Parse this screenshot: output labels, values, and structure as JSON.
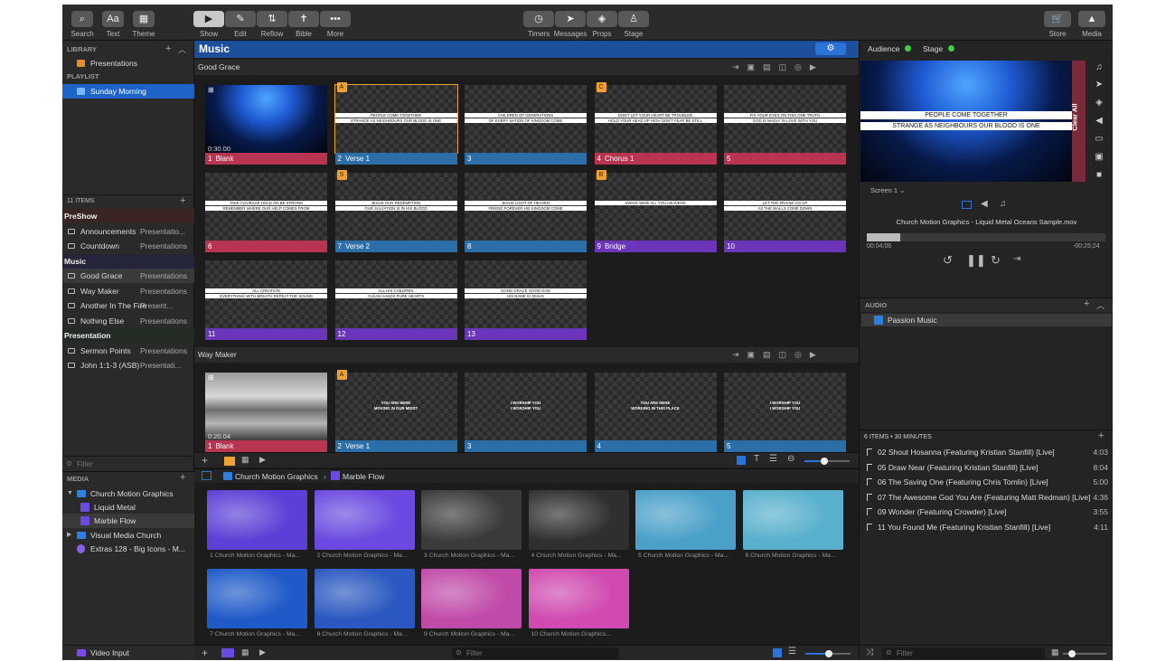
{
  "toolbar": {
    "left": [
      {
        "label": "Search",
        "icon": "magnifier-icon"
      },
      {
        "label": "Text",
        "glyph": "Aa"
      },
      {
        "label": "Theme",
        "icon": "theme-icon"
      }
    ],
    "mode": [
      {
        "label": "Show"
      },
      {
        "label": "Edit"
      },
      {
        "label": "Reflow"
      },
      {
        "label": "Bible"
      },
      {
        "label": "More"
      }
    ],
    "center": [
      {
        "label": "Timers"
      },
      {
        "label": "Messages"
      },
      {
        "label": "Props"
      },
      {
        "label": "Stage"
      }
    ],
    "right": [
      {
        "label": "Store"
      },
      {
        "label": "Media"
      }
    ]
  },
  "library": {
    "header": "LIBRARY",
    "presentations": "Presentations",
    "playlist_header": "PLAYLIST",
    "playlist": "Sunday Morning",
    "items_count": "11 ITEMS",
    "groups": [
      {
        "name": "PreShow",
        "items": [
          {
            "name": "Announcements",
            "type": "Presentatio..."
          },
          {
            "name": "Countdown",
            "type": "Presentations"
          }
        ]
      },
      {
        "name": "Music",
        "items": [
          {
            "name": "Good Grace",
            "type": "Presentations"
          },
          {
            "name": "Way Maker",
            "type": "Presentations"
          },
          {
            "name": "Another In The Fire",
            "type": "Present..."
          },
          {
            "name": "Nothing Else",
            "type": "Presentations"
          }
        ]
      },
      {
        "name": "Presentation",
        "items": [
          {
            "name": "Sermon Points",
            "type": "Presentations"
          },
          {
            "name": "John 1:1-3 (ASB)",
            "type": "Presentati..."
          }
        ]
      }
    ],
    "filter": "Filter"
  },
  "media_tree": {
    "header": "MEDIA",
    "items": [
      {
        "name": "Church Motion Graphics"
      },
      {
        "name": "Liquid Metal"
      },
      {
        "name": "Marble Flow"
      },
      {
        "name": "Visual Media Church"
      },
      {
        "name": "Extras 128 - Big Icons - M..."
      }
    ],
    "video_input": "Video Input"
  },
  "center": {
    "title": "Music",
    "sections": [
      {
        "name": "Good Grace",
        "slides": [
          {
            "num": "1",
            "label": "Blank",
            "time": "0:30.00",
            "color": "red",
            "kind": "ocean",
            "l1": "",
            "l2": ""
          },
          {
            "num": "2",
            "label": "Verse 1",
            "badge": "A",
            "color": "blue",
            "l1": "PEOPLE COME TOGETHER",
            "l2": "STRANGE AS NEIGHBOURS OUR BLOOD IS ONE"
          },
          {
            "num": "3",
            "label": "",
            "color": "blue",
            "l1": "CHILDREN OF GENERATIONS",
            "l2": "OF EVERY NATION OF KINGDOM COME"
          },
          {
            "num": "4",
            "label": "Chorus 1",
            "badge": "C",
            "color": "red",
            "l1": "DON'T LET YOUR HEART BE TROUBLED",
            "l2": "HOLD YOUR HEAD UP HIGH DON'T FEAR BE STILL"
          },
          {
            "num": "5",
            "label": "",
            "color": "red",
            "l1": "FIX YOUR EYES ON THIS ONE TRUTH",
            "l2": "GOD IS MADLY IN LOVE WITH YOU"
          },
          {
            "num": "6",
            "label": "",
            "color": "red",
            "l1": "TAKE COURAGE HOLD ON BE STRONG",
            "l2": "REMEMBER WHERE OUR HELP COMES FROM"
          },
          {
            "num": "7",
            "label": "Verse 2",
            "badge": "S",
            "color": "blue",
            "l1": "JESUS OUR REDEMPTION",
            "l2": "OUR SALVATION IS IN HIS BLOOD"
          },
          {
            "num": "8",
            "label": "",
            "color": "blue",
            "l1": "JESUS LIGHT OF HEAVEN",
            "l2": "FRIEND FOREVER HIS KINGDOM COME"
          },
          {
            "num": "9",
            "label": "Bridge",
            "badge": "B",
            "color": "purple",
            "l1": "SWING WIDE ALL YOU HEAVENS",
            "l2": ""
          },
          {
            "num": "10",
            "label": "",
            "color": "purple",
            "l1": "LET THE PRAISE GO UP",
            "l2": "AS THE WALLS COME DOWN"
          },
          {
            "num": "11",
            "label": "",
            "color": "purple",
            "l1": "ALL CREATION",
            "l2": "EVERYTHING WITH BREATH REPEAT THE SOUND"
          },
          {
            "num": "12",
            "label": "",
            "color": "purple",
            "l1": "ALL HIS CHILDREN",
            "l2": "CLEAN HANDS PURE HEARTS"
          },
          {
            "num": "13",
            "label": "",
            "color": "purple",
            "l1": "GOOD GRACE GOOD GOD",
            "l2": "HIS NAME IS JESUS"
          }
        ]
      },
      {
        "name": "Way Maker",
        "slides": [
          {
            "num": "1",
            "label": "Blank",
            "time": "0:20.04",
            "color": "red",
            "kind": "snow",
            "l1": "",
            "l2": ""
          },
          {
            "num": "2",
            "label": "Verse 1",
            "badge": "A",
            "color": "blue",
            "l1": "YOU ARE HERE",
            "l2": "MOVING IN OUR MIDST"
          },
          {
            "num": "3",
            "label": "",
            "color": "blue",
            "l1": "I WORSHIP YOU",
            "l2": "I WORSHIP YOU"
          },
          {
            "num": "4",
            "label": "",
            "color": "blue",
            "l1": "YOU ARE HERE",
            "l2": "WORKING IN THIS PLACE"
          },
          {
            "num": "5",
            "label": "",
            "color": "blue",
            "l1": "I WORSHIP YOU",
            "l2": "I WORSHIP YOU"
          }
        ]
      }
    ],
    "breadcrumb": [
      "Church Motion Graphics",
      "Marble Flow"
    ],
    "media": [
      {
        "cap": "1 Church Motion Graphics - Ma...",
        "bg": "#5b3fd6"
      },
      {
        "cap": "2 Church Motion Graphics - Ma...",
        "bg": "#6a4ae0"
      },
      {
        "cap": "3 Church Motion Graphics - Ma...",
        "bg": "#3a3a3a"
      },
      {
        "cap": "4 Church Motion Graphics - Ma...",
        "bg": "#2f2f2f"
      },
      {
        "cap": "5 Church Motion Graphics - Ma...",
        "bg": "#4aa0c8"
      },
      {
        "cap": "6 Church Motion Graphics - Ma...",
        "bg": "#58b0cc"
      },
      {
        "cap": "7 Church Motion Graphics - Ma...",
        "bg": "#1f5ac8"
      },
      {
        "cap": "8 Church Motion Graphics - Ma...",
        "bg": "#2a58c0"
      },
      {
        "cap": "9 Church Motion Graphics - Ma...",
        "bg": "#c04aa8"
      },
      {
        "cap": "10 Church Motion Graphics...",
        "bg": "#d04ab0"
      }
    ],
    "filter": "Filter"
  },
  "right": {
    "audience": "Audience",
    "stage": "Stage",
    "preview": {
      "l1": "PEOPLE COME TOGETHER",
      "l2": "STRANGE AS NEIGHBOURS OUR BLOOD IS ONE"
    },
    "clear_all": "Clear All",
    "screen": "Screen 1",
    "now_playing": "Church Motion Graphics - Liquid Metal Oceans Sample.mov",
    "elapsed": "00:04;06",
    "remaining": "-00:25;24",
    "progress": 0.14,
    "audio_header": "AUDIO",
    "audio_playlist": "Passion Music",
    "tracks_header": "6 ITEMS • 30 MINUTES",
    "tracks": [
      {
        "t": "02 Shout Hosanna (Featuring Kristian Stanfill) [Live]",
        "d": "4:03"
      },
      {
        "t": "05 Draw Near (Featuring Kristian Stanfill) [Live]",
        "d": "8:04"
      },
      {
        "t": "06 The Saving One (Featuring Chris Tomlin) [Live]",
        "d": "5:00"
      },
      {
        "t": "07 The Awesome God You Are (Featuring Matt Redman) [Live]",
        "d": "4:36"
      },
      {
        "t": "09 Wonder (Featuring Crowder) [Live]",
        "d": "3:55"
      },
      {
        "t": "11 You Found Me (Featuring Kristian Stanfill) [Live]",
        "d": "4:11"
      }
    ],
    "filter": "Filter"
  }
}
